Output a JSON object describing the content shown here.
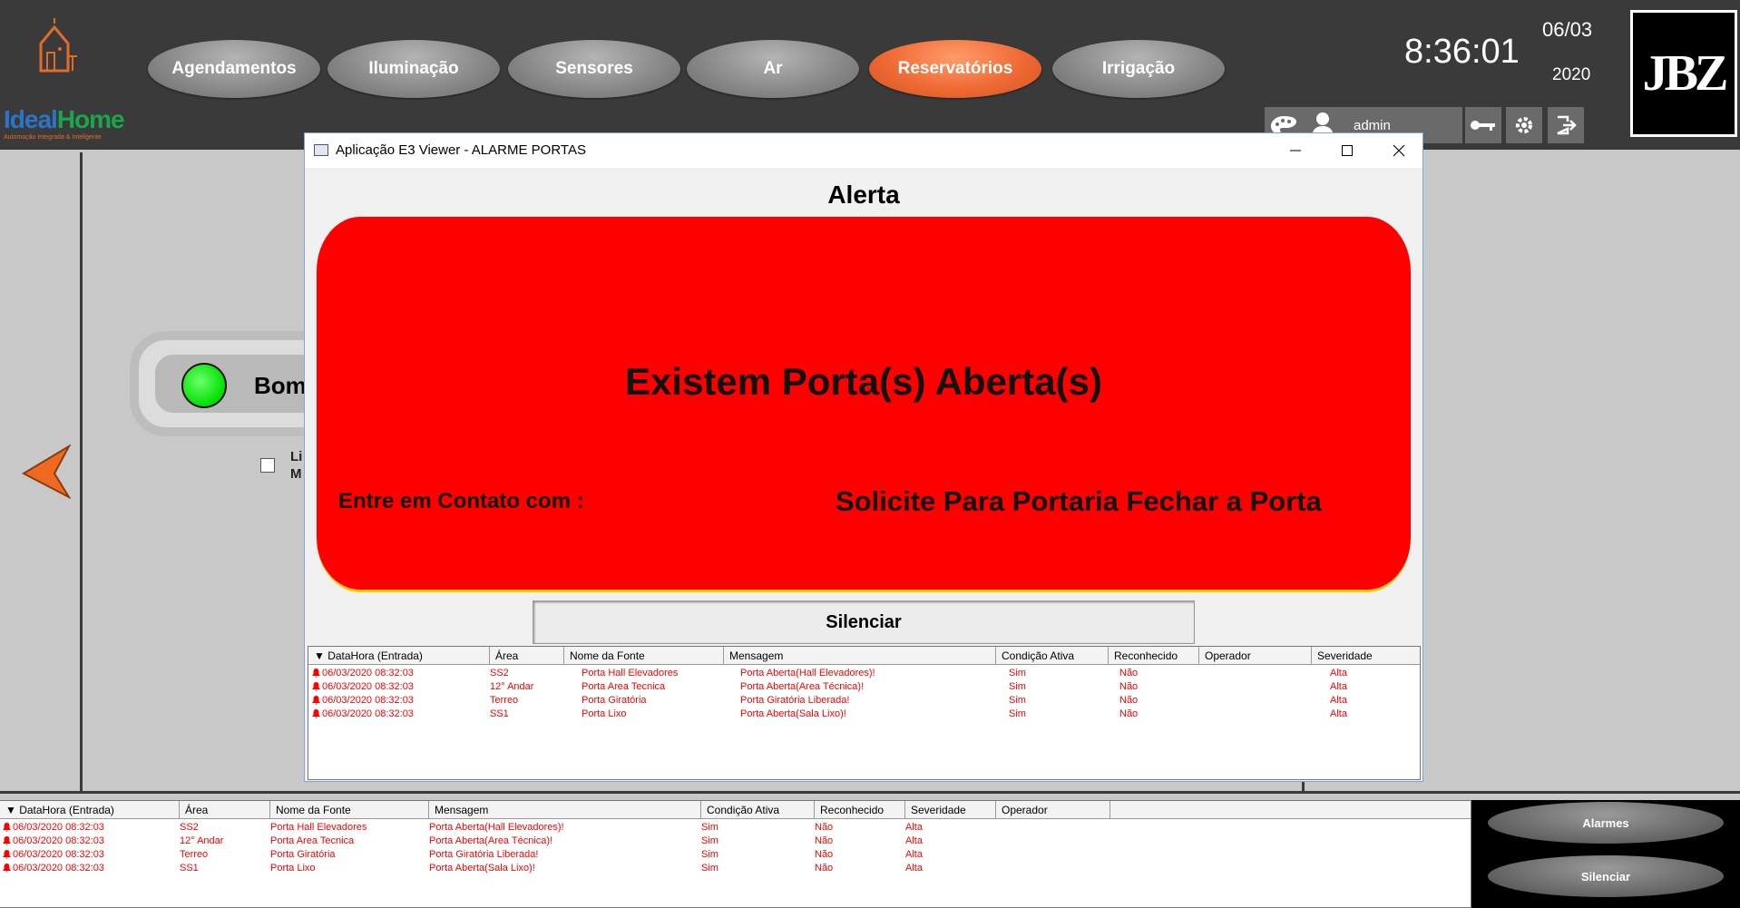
{
  "topbar": {
    "logo": {
      "ideal": "Ideal",
      "home": "Home",
      "tagline": "Automação Integrada & Inteligente"
    },
    "nav": [
      {
        "label": "Agendamentos",
        "active": false
      },
      {
        "label": "Iluminação",
        "active": false
      },
      {
        "label": "Sensores",
        "active": false
      },
      {
        "label": "Ar",
        "active": false
      },
      {
        "label": "Reservatórios",
        "active": true
      },
      {
        "label": "Irrigação",
        "active": false
      }
    ],
    "clock": "8:36:01",
    "date_day": "06/03",
    "date_year": "2020",
    "brand": "JBZ",
    "user": "admin",
    "icons": [
      "palette-icon",
      "user-icon",
      "key-icon",
      "gear-icon",
      "logout-icon"
    ]
  },
  "background": {
    "pump_label": "Bom",
    "check_label": "Li M"
  },
  "dialog": {
    "title": "Aplicação E3 Viewer - ALARME PORTAS",
    "heading": "Alerta",
    "main_message": "Existem Porta(s) Aberta(s)",
    "contact_label": "Entre em Contato com :",
    "instruction": "Solicite Para Portaria Fechar a Porta",
    "silence_label": "Silenciar",
    "table": {
      "columns": [
        "▼ DataHora (Entrada)",
        "Área",
        "Nome da Fonte",
        "Mensagem",
        "Condição Ativa",
        "Reconhecido",
        "Operador",
        "Severidade"
      ],
      "rows": [
        [
          "06/03/2020 08:32:03",
          "SS2",
          "Porta Hall Elevadores",
          "Porta Aberta(Hall Elevadores)!",
          "Sim",
          "Não",
          "",
          "Alta"
        ],
        [
          "06/03/2020 08:32:03",
          "12° Andar",
          "Porta Area Tecnica",
          "Porta Aberta(Area Técnica)!",
          "Sim",
          "Não",
          "",
          "Alta"
        ],
        [
          "06/03/2020 08:32:03",
          "Terreo",
          "Porta Giratória",
          "Porta Giratória Liberada!",
          "Sim",
          "Não",
          "",
          "Alta"
        ],
        [
          "06/03/2020 08:32:03",
          "SS1",
          "Porta Lixo",
          "Porta Aberta(Sala Lixo)!",
          "Sim",
          "Não",
          "",
          "Alta"
        ]
      ]
    }
  },
  "bottom_table": {
    "columns": [
      "▼ DataHora (Entrada)",
      "Área",
      "Nome da Fonte",
      "Mensagem",
      "Condição Ativa",
      "Reconhecido",
      "Severidade",
      "Operador"
    ],
    "rows": [
      [
        "06/03/2020 08:32:03",
        "SS2",
        "Porta Hall Elevadores",
        "Porta Aberta(Hall Elevadores)!",
        "Sim",
        "Não",
        "Alta",
        ""
      ],
      [
        "06/03/2020 08:32:03",
        "12° Andar",
        "Porta Area Tecnica",
        "Porta Aberta(Area Técnica)!",
        "Sim",
        "Não",
        "Alta",
        ""
      ],
      [
        "06/03/2020 08:32:03",
        "Terreo",
        "Porta Giratória",
        "Porta Giratória Liberada!",
        "Sim",
        "Não",
        "Alta",
        ""
      ],
      [
        "06/03/2020 08:32:03",
        "SS1",
        "Porta Lixo",
        "Porta Aberta(Sala Lixo)!",
        "Sim",
        "Não",
        "Alta",
        ""
      ]
    ]
  },
  "bottom_buttons": {
    "alarms": "Alarmes",
    "silence": "Silenciar"
  },
  "colors": {
    "active_nav": "#ef6a34",
    "alert_red": "#ff0000",
    "status_green": "#00e000",
    "alarm_text": "#ff0000"
  }
}
